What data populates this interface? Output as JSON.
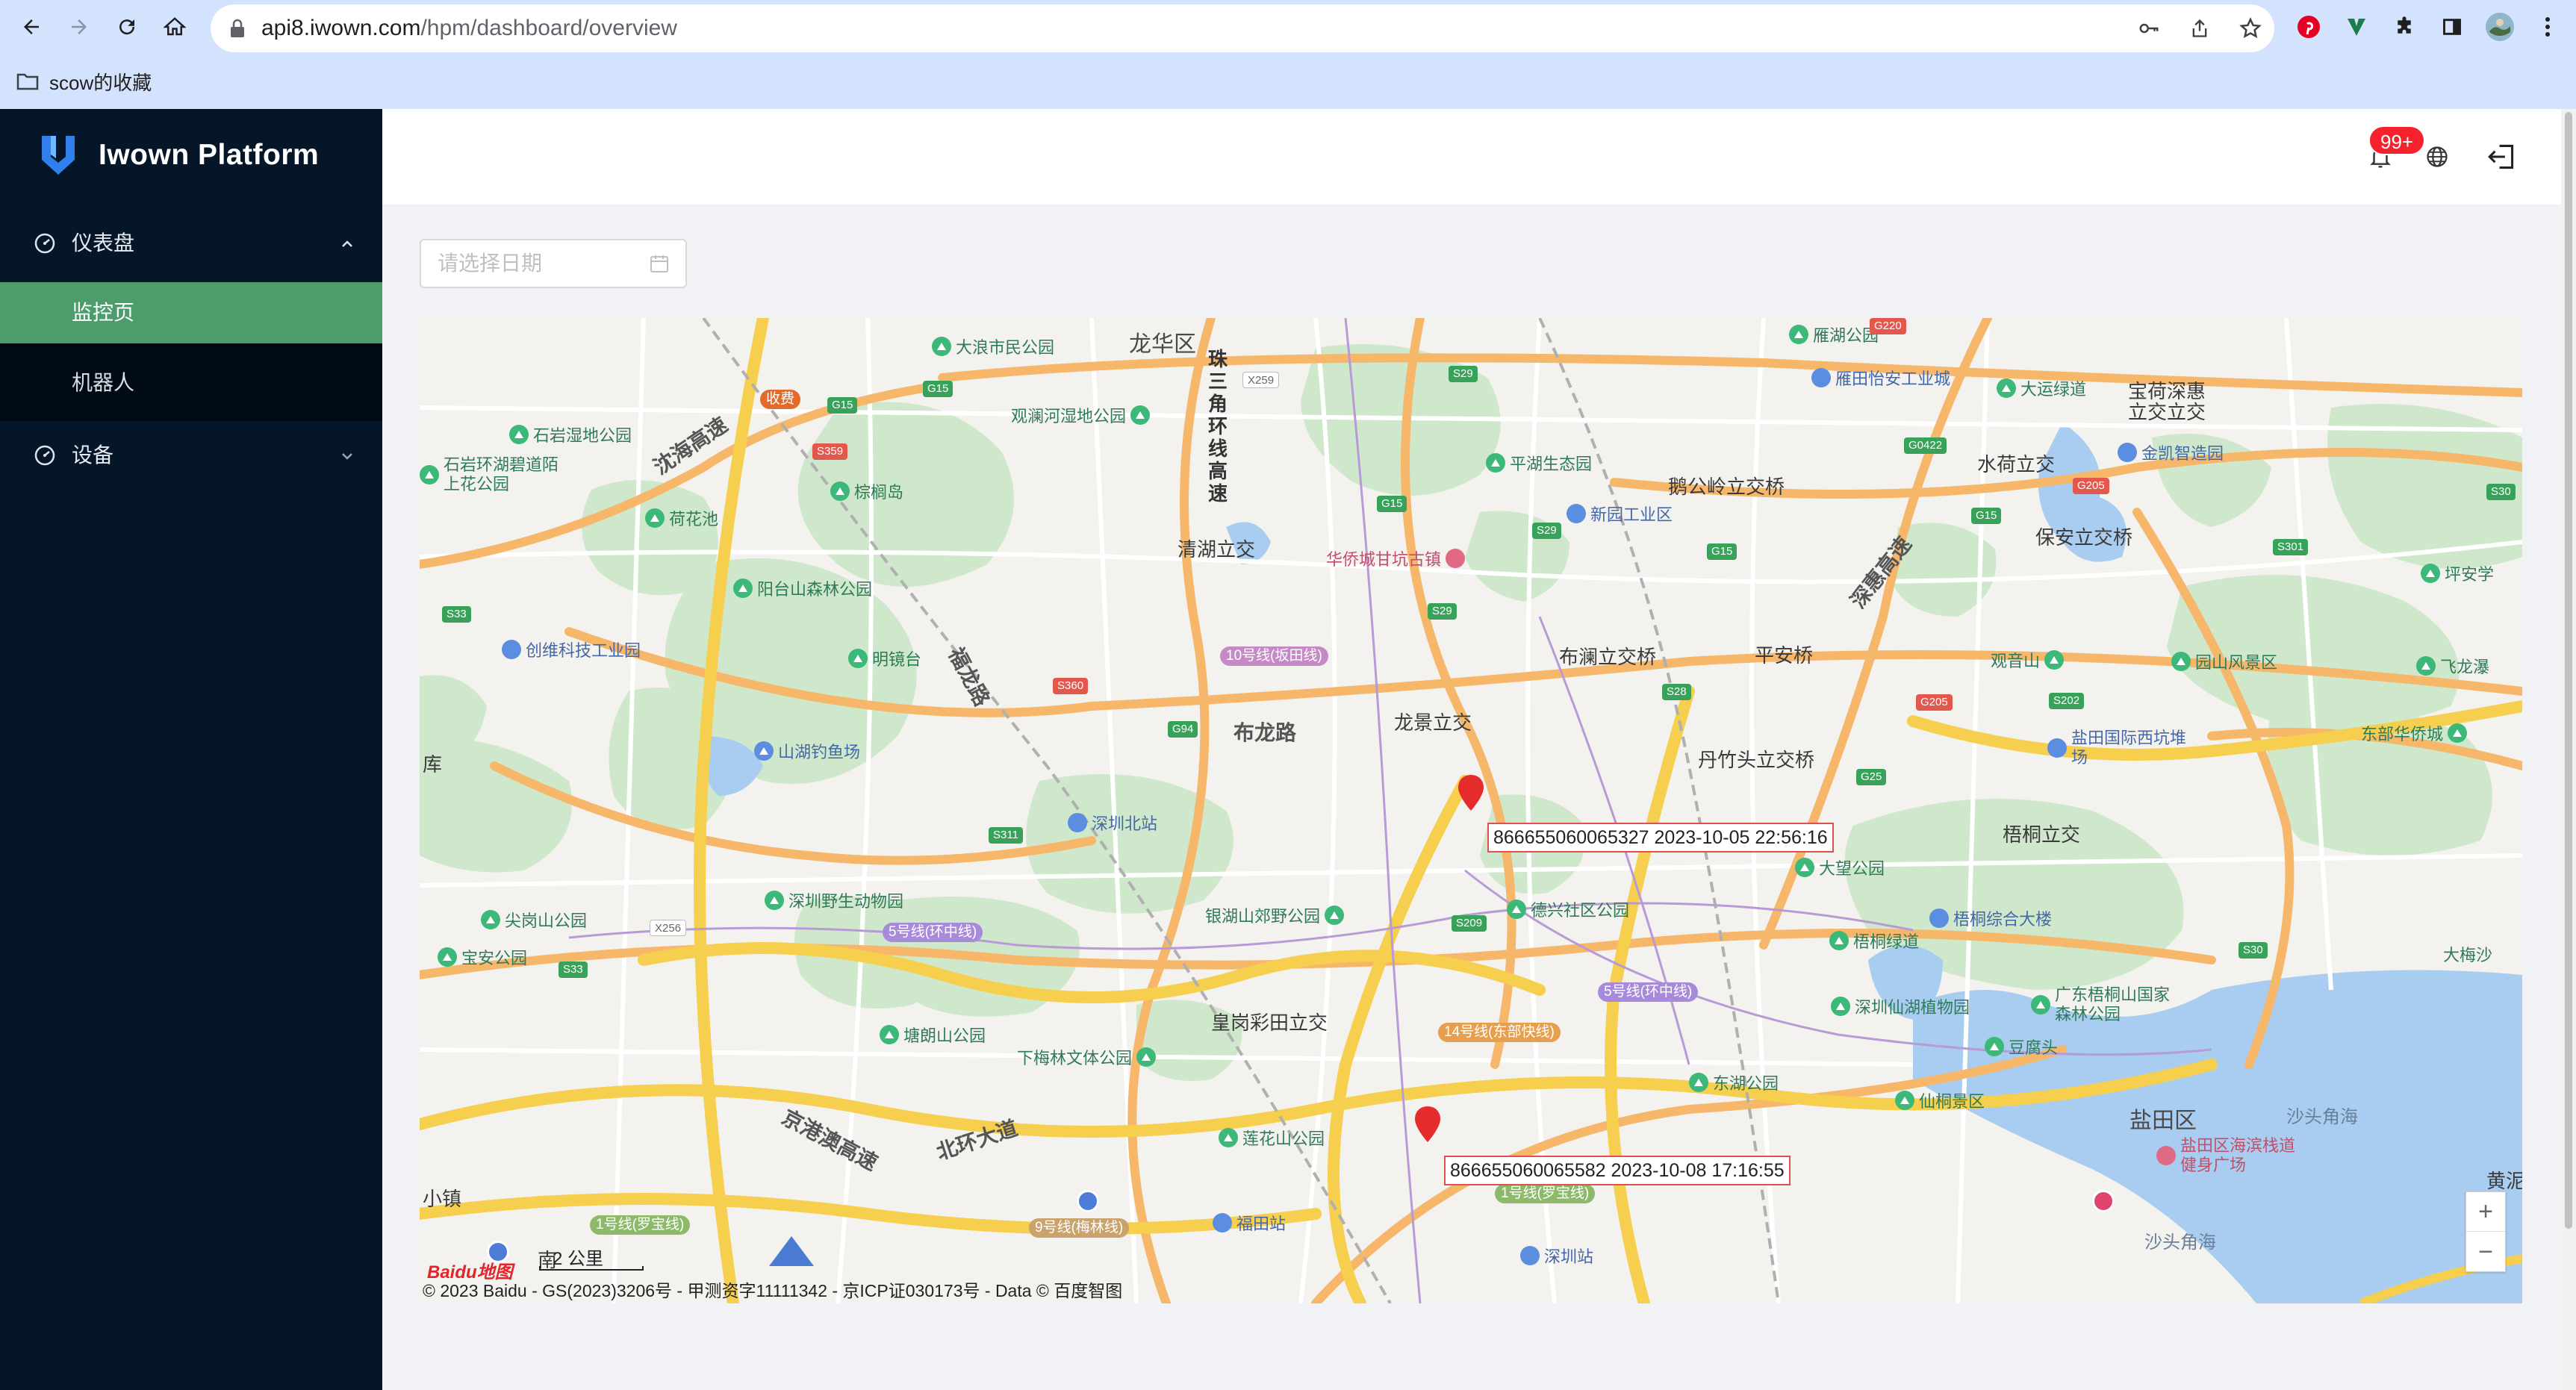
{
  "browser": {
    "url_host": "api8.iwown.com",
    "url_path": "/hpm/dashboard/overview",
    "bookmark_folder": "scow的收藏",
    "icons": [
      "back-icon",
      "forward-icon",
      "reload-icon",
      "home-icon",
      "lock-icon",
      "key-icon",
      "share-icon",
      "star-icon",
      "pinterest-icon",
      "vuetify-icon",
      "puzzle-icon",
      "sidepanel-icon",
      "profile-avatar",
      "more-icon",
      "folder-icon"
    ]
  },
  "app": {
    "name": "Iwown Platform",
    "accent_color": "#4d9c6c",
    "sidebar_color": "#061629"
  },
  "sidebar": {
    "dashboard": {
      "label": "仪表盘",
      "icon": "dashboard-icon",
      "expanded": true
    },
    "subitems": [
      {
        "label": "监控页",
        "active": true
      },
      {
        "label": "机器人",
        "active": false
      }
    ],
    "devices": {
      "label": "设备",
      "icon": "dashboard-icon",
      "expanded": false
    }
  },
  "header": {
    "badge": "99+",
    "icons": [
      "bell-icon",
      "globe-icon",
      "logout-icon"
    ]
  },
  "filter": {
    "date_placeholder": "请选择日期"
  },
  "map": {
    "provider_logo": "Baidu地图",
    "scale_label": "2 公里",
    "copyright": "© 2023 Baidu - GS(2023)3206号 - 甲测资字11111342 - 京ICP证030173号 - Data © 百度智图",
    "zoom_in": "+",
    "zoom_out": "−",
    "markers": [
      {
        "device_id": "866655060065327",
        "timestamp": "2023-10-05 22:56:16"
      },
      {
        "device_id": "866655060065582",
        "timestamp": "2023-10-08 17:16:55"
      }
    ],
    "districts": [
      "龙华区",
      "盐田区"
    ],
    "roads": [
      "沈海高速",
      "福龙路",
      "布龙路",
      "北环大道",
      "京港澳高速",
      "珠三角环线高速",
      "深惠高速"
    ],
    "interchanges": [
      "清湖立交",
      "龙景立交",
      "布澜立交桥",
      "丹竹头立交桥",
      "皇岗彩田立交",
      "鹅公岭立交桥",
      "水荷立交",
      "保安立交桥",
      "平安桥",
      "梧桐立交"
    ],
    "sea_labels": [
      "沙头角海",
      "沙头角海"
    ],
    "small_places": [
      "库",
      "小镇",
      "南",
      "黄泥",
      "宝荷深惠立交立交"
    ],
    "parks": [
      "大浪市民公园",
      "观澜河湿地公园",
      "石岩湿地公园",
      "石岩环湖碧道陌上花公园",
      "棕榈岛",
      "荷花池",
      "阳台山森林公园",
      "明镜台",
      "山湖钓鱼场",
      "尖岗山公园",
      "宝安公园",
      "深圳野生动物园",
      "银湖山郊野公园",
      "塘朗山公园",
      "下梅林文体公园",
      "莲花山公园",
      "平湖生态园",
      "德兴社区公园",
      "梧桐绿道",
      "深圳仙湖植物园",
      "广东梧桐山国家森林公园",
      "东湖公园",
      "仙桐景区",
      "豆腐头",
      "观音山",
      "园山风景区",
      "飞龙瀑",
      "东部华侨城",
      "坪安学",
      "大梅沙",
      "大运绿道",
      "大望公园",
      "雁湖公园"
    ],
    "buildings": [
      "创维科技工业园",
      "新园工业区",
      "雁田怡安工业城",
      "金凯智造园",
      "梧桐综合大楼"
    ],
    "stations": [
      "深圳北站",
      "福田站",
      "深圳站",
      "盐田国际西坑堆场",
      "盐田区海滨栈道健身广场"
    ],
    "scenic": [
      "华侨城甘坑古镇"
    ],
    "metro_lines": [
      "10号线(坂田线)",
      "5号线(环中线)",
      "5号线(环中线)",
      "14号线(东部快线)",
      "1号线(罗宝线)",
      "9号线(梅林线)",
      "1号线(罗宝线)"
    ],
    "highway_shields": [
      "G15",
      "G15",
      "S359",
      "S33",
      "S360",
      "G94",
      "S311",
      "X256",
      "S33",
      "X259",
      "S29",
      "G15",
      "S29",
      "S29",
      "S209",
      "S28",
      "G15",
      "G205",
      "S202",
      "G205",
      "S30",
      "G0422",
      "G15",
      "S301",
      "S30",
      "G25",
      "G220"
    ],
    "toll_label": "收费"
  }
}
